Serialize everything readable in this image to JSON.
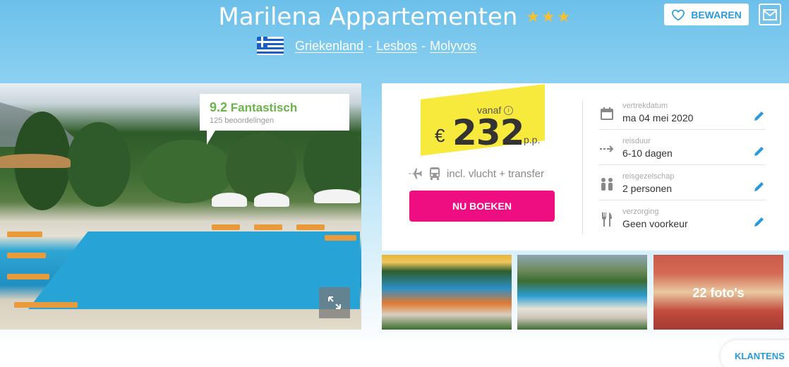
{
  "hotel": {
    "name": "Marilena Appartementen",
    "stars": 3
  },
  "breadcrumb": {
    "country": "Griekenland",
    "island": "Lesbos",
    "town": "Molyvos",
    "separator": "-"
  },
  "actions": {
    "save_label": "BEWAREN"
  },
  "rating": {
    "score": "9.2",
    "label": "Fantastisch",
    "reviews": "125 beoordelingen"
  },
  "price": {
    "from_label": "vanaf",
    "currency": "€",
    "amount": "232",
    "per_person": "p.p.",
    "includes": "incl. vlucht + transfer",
    "book_label": "NU BOEKEN"
  },
  "options": [
    {
      "label": "vertrekdatum",
      "value": "ma 04 mei 2020",
      "icon": "calendar-icon"
    },
    {
      "label": "reisduur",
      "value": "6-10 dagen",
      "icon": "duration-arrow-icon"
    },
    {
      "label": "reisgezelschap",
      "value": "2 personen",
      "icon": "people-icon"
    },
    {
      "label": "verzorging",
      "value": "Geen voorkeur",
      "icon": "cutlery-icon"
    }
  ],
  "gallery": {
    "photo_count_label": "22 foto's"
  },
  "chat": {
    "label": "KLANTENS"
  },
  "colors": {
    "accent_blue": "#2a9ad9",
    "book_pink": "#ee0e82",
    "price_highlight": "#f7ea3c",
    "rating_green": "#6ab24b",
    "star_gold": "#f6c033"
  }
}
